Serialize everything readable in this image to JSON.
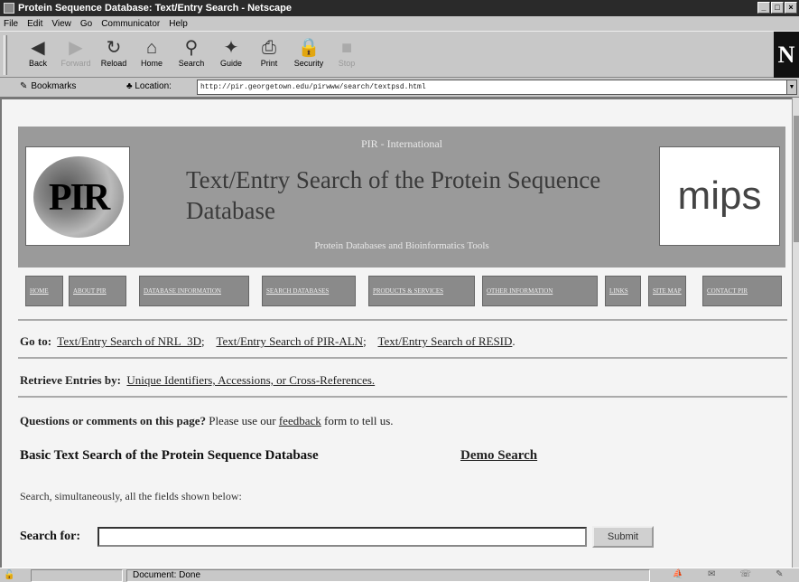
{
  "window": {
    "title": "Protein Sequence Database: Text/Entry Search - Netscape",
    "controls": [
      "_",
      "□",
      "×"
    ]
  },
  "menu": [
    "File",
    "Edit",
    "View",
    "Go",
    "Communicator",
    "Help"
  ],
  "toolbar": {
    "buttons": [
      {
        "label": "Back",
        "icon": "back-arrow-icon",
        "glyph": "◀"
      },
      {
        "label": "Forward",
        "icon": "forward-arrow-icon",
        "glyph": "▶"
      },
      {
        "label": "Reload",
        "icon": "reload-icon",
        "glyph": "↻"
      },
      {
        "label": "Home",
        "icon": "home-icon",
        "glyph": "⌂"
      },
      {
        "label": "Search",
        "icon": "search-icon",
        "glyph": "⚲"
      },
      {
        "label": "Guide",
        "icon": "guide-icon",
        "glyph": "✦"
      },
      {
        "label": "Print",
        "icon": "print-icon",
        "glyph": "⎙"
      },
      {
        "label": "Security",
        "icon": "security-icon",
        "glyph": "🔒"
      },
      {
        "label": "Stop",
        "icon": "stop-icon",
        "glyph": "■"
      }
    ],
    "throbber": "N"
  },
  "location": {
    "bookmarks_label": "Bookmarks",
    "location_label": "Location:",
    "url": "http://pir.georgetown.edu/pirwww/search/textpsd.html"
  },
  "banner": {
    "org": "PIR - International",
    "title": "Text/Entry Search of the Protein Sequence Database",
    "subtitle": "Protein Databases and Bioinformatics Tools",
    "pir_logo_text": "PIR",
    "mips_logo_text": "mips"
  },
  "nav": [
    "HOME",
    "ABOUT PIR",
    "DATABASE INFORMATION",
    "SEARCH DATABASES",
    "PRODUCTS & SERVICES",
    "OTHER INFORMATION",
    "LINKS",
    "SITE MAP",
    "CONTACT PIR"
  ],
  "goto": {
    "label": "Go to:",
    "links": [
      "Text/Entry Search of NRL_3D",
      "Text/Entry Search of PIR-ALN",
      "Text/Entry Search of RESID"
    ],
    "separators": [
      ";",
      ";",
      "."
    ]
  },
  "retrieve": {
    "label": "Retrieve Entries by:",
    "link": "Unique Identifiers, Accessions, or Cross-References."
  },
  "questions": {
    "bold": "Questions or comments on this page?",
    "before_link": " Please use our ",
    "link": "feedback",
    "after_link": " form to tell us."
  },
  "basic_search": {
    "heading": "Basic Text Search of the Protein Sequence Database",
    "demo_link": "Demo Search",
    "description": "Search, simultaneously, all the fields shown below:",
    "search_label": "Search for:",
    "search_value": "",
    "submit_label": "Submit"
  },
  "status": {
    "message": "Document: Done"
  }
}
